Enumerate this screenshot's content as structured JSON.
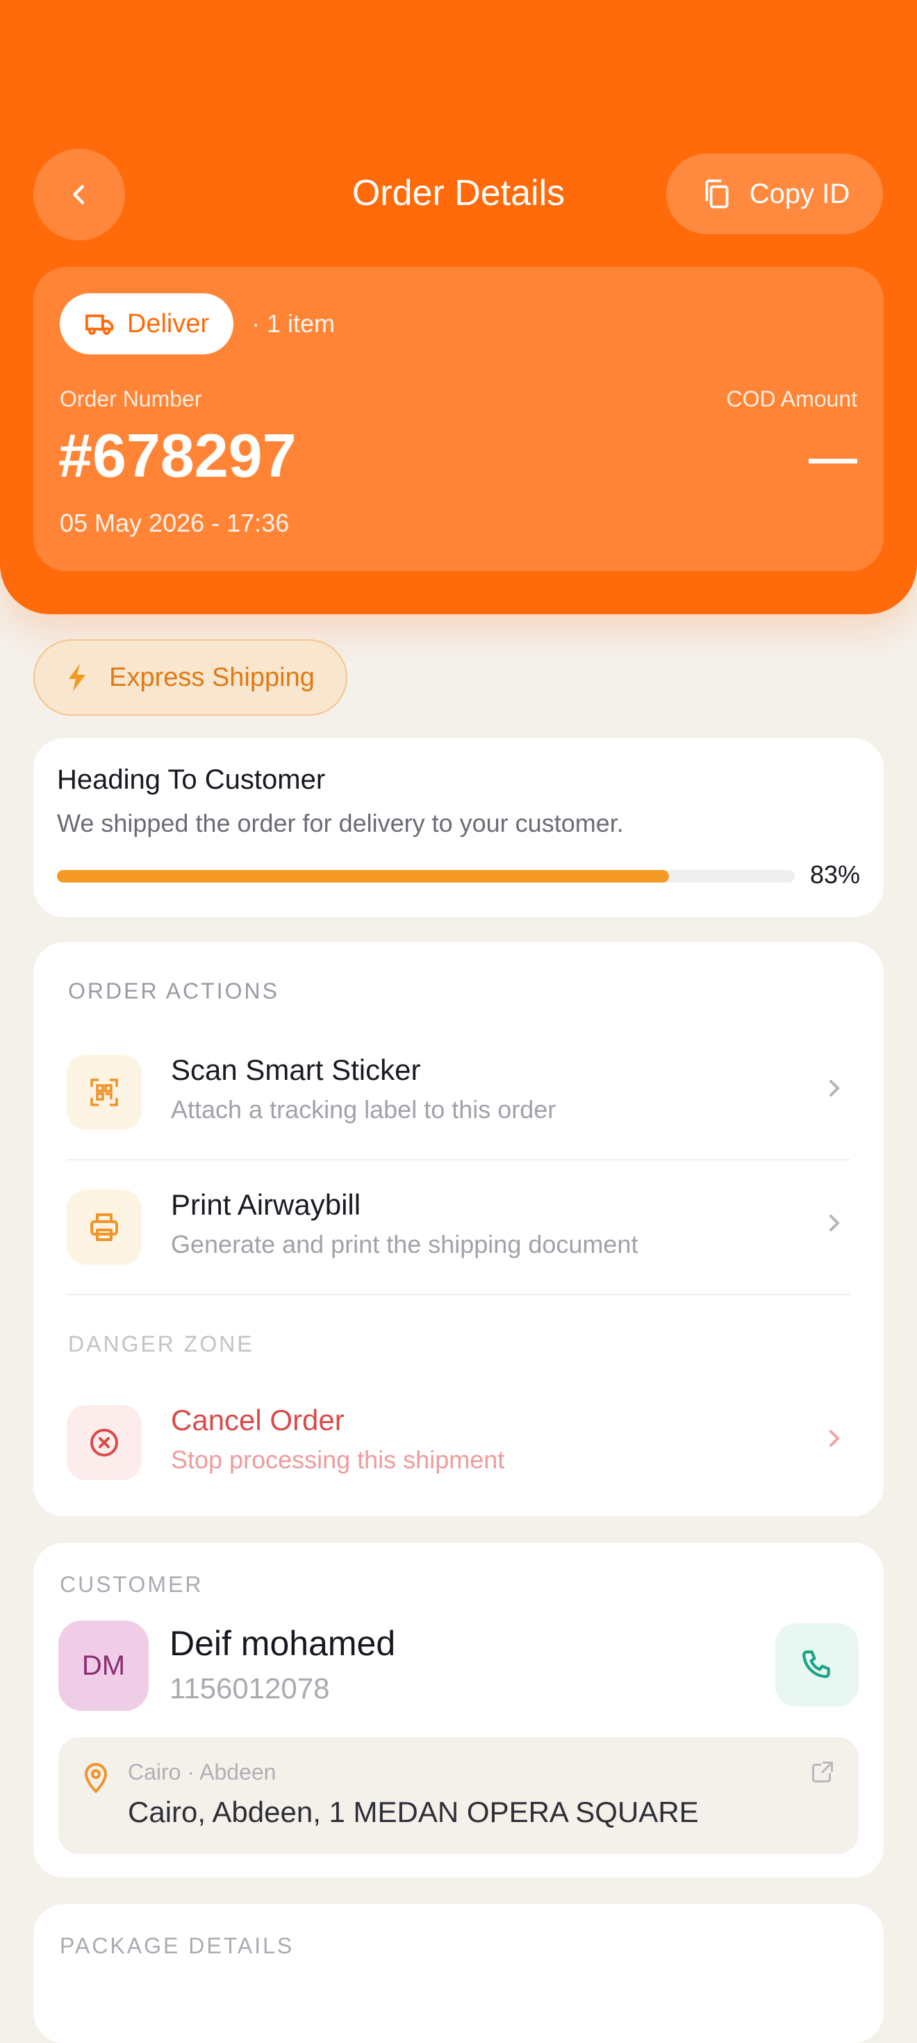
{
  "header": {
    "title": "Order Details",
    "copy_label": "Copy ID",
    "accent_color": "#ff6a0a"
  },
  "order": {
    "type_label": "Deliver",
    "item_count": "· 1 item",
    "number_label": "Order Number",
    "number": "#678297",
    "cod_label": "COD Amount",
    "cod_value": "—",
    "date": "05 May 2026 - 17:36"
  },
  "express": {
    "label": "Express Shipping"
  },
  "status": {
    "title": "Heading To Customer",
    "description": "We shipped the order for delivery to your customer.",
    "progress": 0.83,
    "progress_label": "83%"
  },
  "actions": {
    "section_label": "ORDER ACTIONS",
    "items": [
      {
        "title": "Scan Smart Sticker",
        "subtitle": "Attach a tracking label to this order",
        "icon": "qr-scan-icon"
      },
      {
        "title": "Print Airwaybill",
        "subtitle": "Generate and print the shipping document",
        "icon": "printer-icon"
      }
    ],
    "danger_label": "DANGER ZONE",
    "cancel": {
      "title": "Cancel Order",
      "subtitle": "Stop processing this shipment",
      "icon": "x-circle-icon"
    }
  },
  "customer": {
    "section_label": "CUSTOMER",
    "initials": "DM",
    "name": "Deif mohamed",
    "phone": "1156012078",
    "address_region": "Cairo · Abdeen",
    "address_line": "Cairo, Abdeen, 1 MEDAN OPERA SQUARE"
  },
  "package": {
    "section_label": "PACKAGE DETAILS"
  }
}
